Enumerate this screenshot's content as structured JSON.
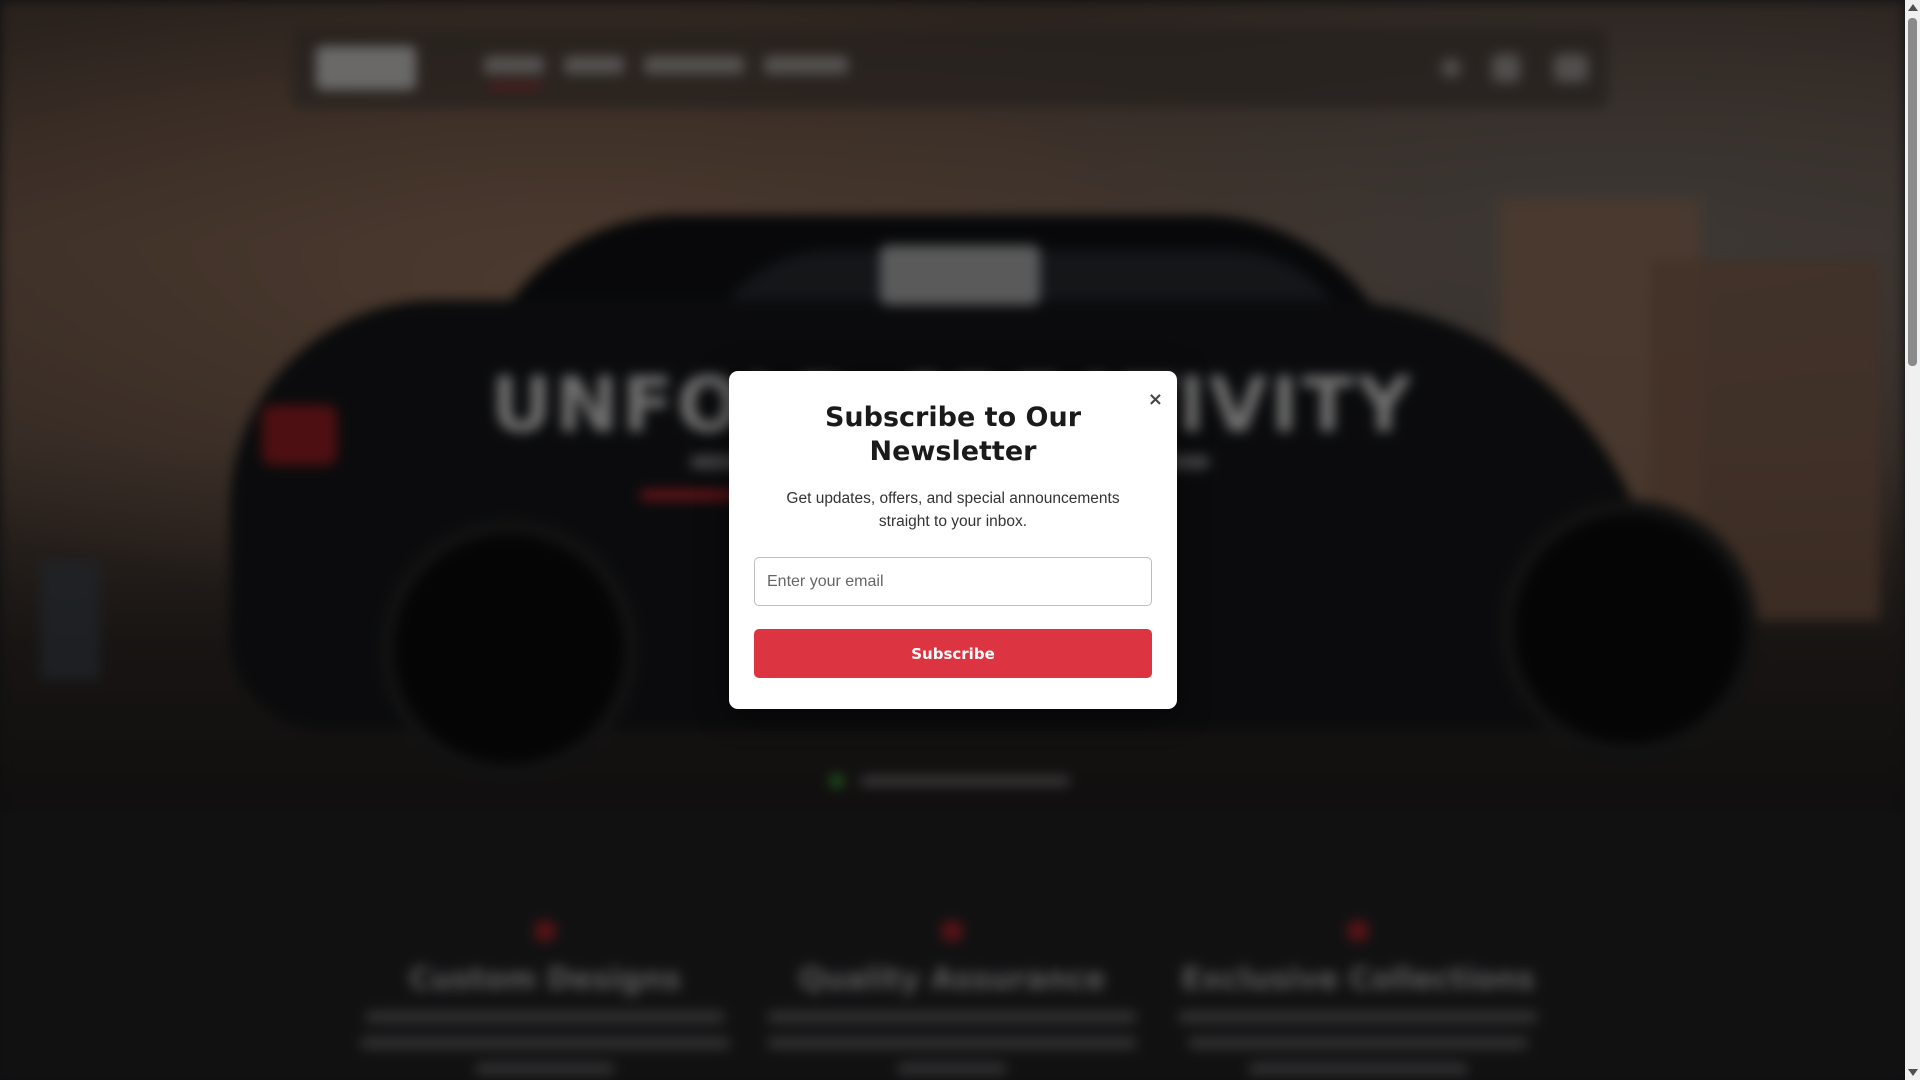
{
  "hero": {
    "title": "UNFOLD CREATIVITY"
  },
  "features": [
    {
      "title": "Custom Designs"
    },
    {
      "title": "Quality Assurance"
    },
    {
      "title": "Exclusive Collections"
    }
  ],
  "modal": {
    "close_label": "×",
    "title": "Subscribe to Our Newsletter",
    "text": "Get updates, offers, and special announcements straight to your inbox.",
    "email_placeholder": "Enter your email",
    "subscribe_label": "Subscribe"
  },
  "colors": {
    "accent": "#dc3441",
    "modal_bg": "#ffffff",
    "overlay": "rgba(0,0,0,0.45)"
  }
}
